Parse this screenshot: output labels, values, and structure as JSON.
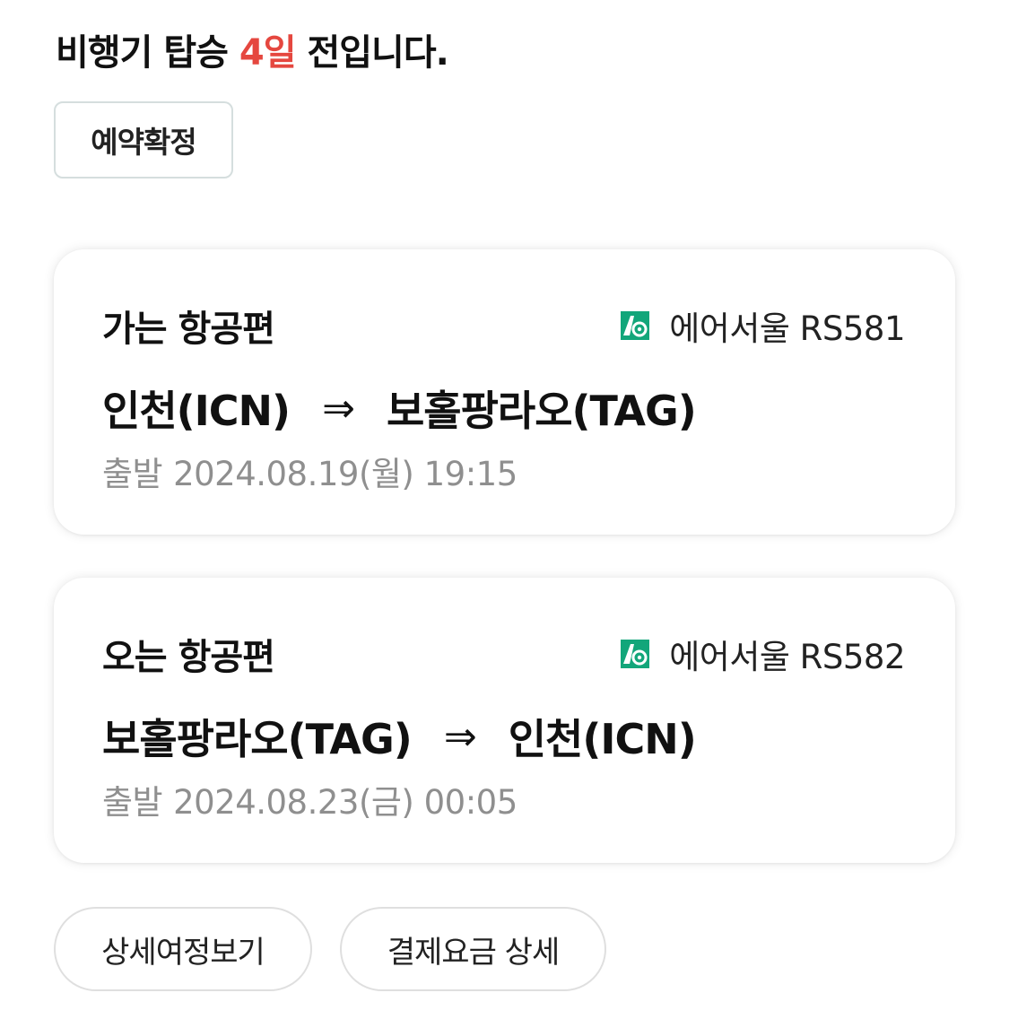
{
  "header": {
    "prefix": "비행기 탑승",
    "days": "4일",
    "suffix": "전입니다."
  },
  "status": {
    "label": "예약확정"
  },
  "flights": [
    {
      "title": "가는 항공편",
      "airline": "에어서울 RS581",
      "airline_icon": "airseoul-logo-icon",
      "origin": "인천(ICN)",
      "arrow": "⇒",
      "destination": "보홀팡라오(TAG)",
      "departure_label": "출발",
      "departure_datetime": "2024.08.19(월) 19:15"
    },
    {
      "title": "오는 항공편",
      "airline": "에어서울 RS582",
      "airline_icon": "airseoul-logo-icon",
      "origin": "보홀팡라오(TAG)",
      "arrow": "⇒",
      "destination": "인천(ICN)",
      "departure_label": "출발",
      "departure_datetime": "2024.08.23(금) 00:05"
    }
  ],
  "actions": {
    "itinerary_label": "상세여정보기",
    "fare_label": "결제요금 상세"
  },
  "colors": {
    "accent_days": "#e5473f",
    "logo_green": "#12a67a",
    "muted_text": "#8f8f8f"
  }
}
